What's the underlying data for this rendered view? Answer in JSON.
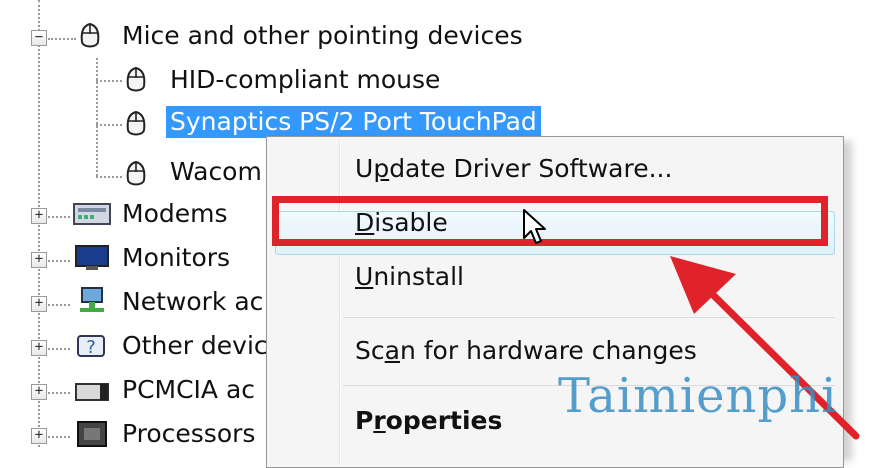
{
  "tree": {
    "category_mice": "Mice and other pointing devices",
    "mice_children": [
      {
        "label": "HID-compliant mouse"
      },
      {
        "label": "Synaptics PS/2 Port TouchPad"
      },
      {
        "label": "Wacom"
      }
    ],
    "categories": [
      {
        "label": "Modems",
        "icon": "modem-icon"
      },
      {
        "label": "Monitors",
        "icon": "monitor-icon"
      },
      {
        "label": "Network ac",
        "icon": "network-adapter-icon"
      },
      {
        "label": "Other devic",
        "icon": "other-devices-icon"
      },
      {
        "label": "PCMCIA ac",
        "icon": "pcmcia-icon"
      },
      {
        "label": "Processors",
        "icon": "processor-icon"
      }
    ],
    "expander_collapsed": "+",
    "expander_expanded": "−"
  },
  "context_menu": {
    "update_prefix": "U",
    "update_mnemonic": "p",
    "update_suffix": "date Driver Software...",
    "disable_mnemonic": "D",
    "disable_suffix": "isable",
    "uninstall_mnemonic": "U",
    "uninstall_suffix": "ninstall",
    "scan_prefix": "Sc",
    "scan_mnemonic": "a",
    "scan_suffix": "n for hardware changes",
    "properties_prefix": "P",
    "properties_mnemonic": "r",
    "properties_suffix": "operties"
  },
  "annotation": {
    "highlight_color": "#e0232a",
    "arrow_color": "#e0232a"
  },
  "watermark": "Taimienphi",
  "colors": {
    "selection": "#3399ff",
    "menu_hover": "#e0f1fa"
  }
}
